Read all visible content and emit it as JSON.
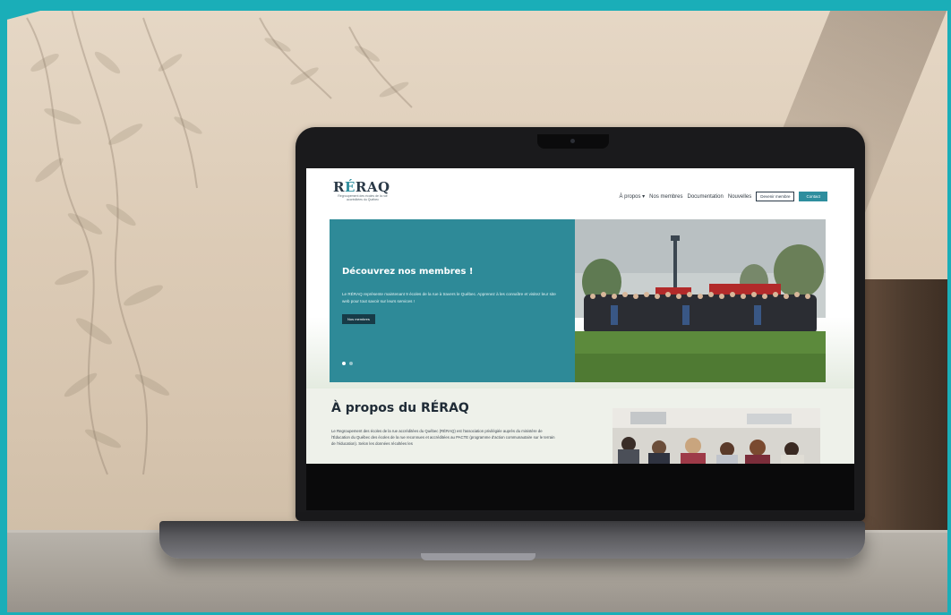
{
  "site": {
    "logo": {
      "text_main": "RÉRAQ",
      "subtitle": "Regroupement des écoles de la rue accréditées du Québec"
    },
    "nav": {
      "items": [
        "À propos ▾",
        "Nos membres",
        "Documentation",
        "Nouvelles"
      ],
      "become_member": "Devenir membre",
      "contact": "Contact"
    },
    "hero": {
      "title": "Découvrez nos membres !",
      "text": "Le RÉRAQ représente maintenant 9 écoles de la rue à travers le Québec. Apprenez à les connaître et visitez leur site web pour tout savoir sur leurs services !",
      "button": "Nos membres",
      "slides_total": 2,
      "slide_active": 1
    },
    "about": {
      "title": "À propos du RÉRAQ",
      "text": "Le Regroupement des écoles de la rue accréditées du Québec (RÉRAQ) est l'association privilégiée auprès du ministère de l'Éducation du Québec des écoles de la rue reconnues et accréditées au PACTE (programme d'action communautaire sur le terrain de l'éducation). Selon les données récoltées les"
    }
  },
  "colors": {
    "accent_frame": "#1aaeb8",
    "teal": "#2e8a98",
    "dark_button": "#173b47",
    "heading": "#1f2b36"
  }
}
